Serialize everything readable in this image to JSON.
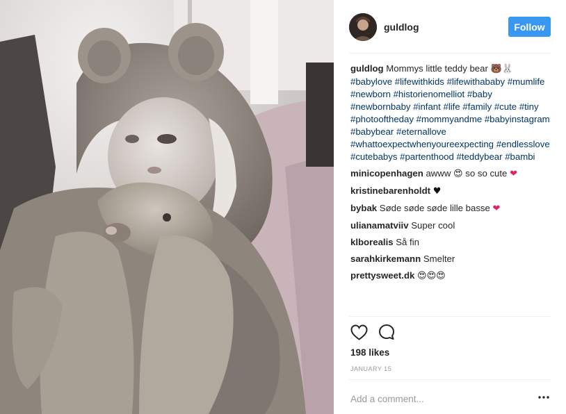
{
  "post": {
    "username": "guldlog",
    "follow_label": "Follow",
    "caption_text": "Mommys little teddy bear",
    "caption_emojis": "🐻🐰",
    "hashtags": [
      "#babylove",
      "#lifewithkids",
      "#lifewithababy",
      "#mumlife",
      "#newborn",
      "#historienomelliot",
      "#baby",
      "#newbornbaby",
      "#infant",
      "#life",
      "#family",
      "#cute",
      "#tiny",
      "#photooftheday",
      "#mommyandme",
      "#babyinstagram",
      "#babybear",
      "#eternallove",
      "#whattoexpectwhenyoureexpecting",
      "#endlesslove",
      "#cutebabys",
      "#partenthood",
      "#teddybear",
      "#bambi"
    ],
    "comments": [
      {
        "user": "minicopenhagen",
        "text": "awww",
        "emoji": "😍",
        "text2": "so so cute",
        "emoji2": "❤"
      },
      {
        "user": "kristinebarenholdt",
        "text": "",
        "emoji": "♥",
        "text2": "",
        "emoji2": ""
      },
      {
        "user": "bybak",
        "text": "Søde søde søde lille basse",
        "emoji": "❤",
        "text2": "",
        "emoji2": ""
      },
      {
        "user": "ulianamatviiv",
        "text": "Super cool",
        "emoji": "",
        "text2": "",
        "emoji2": ""
      },
      {
        "user": "klborealis",
        "text": "Så fin",
        "emoji": "",
        "text2": "",
        "emoji2": ""
      },
      {
        "user": "sarahkirkemann",
        "text": "Smelter",
        "emoji": "",
        "text2": "",
        "emoji2": ""
      },
      {
        "user": "prettysweet.dk",
        "text": "",
        "emoji": "😍😍😍",
        "text2": "",
        "emoji2": ""
      }
    ],
    "likes": "198 likes",
    "date": "JANUARY 15",
    "comment_placeholder": "Add a comment...",
    "more_icon": "⋯"
  },
  "icons": {
    "heart": "heart-outline-icon",
    "comment": "speech-bubble-icon",
    "more": "ellipsis-icon"
  },
  "colors": {
    "follow_bg": "#3897f0",
    "hashtag": "#003569",
    "muted": "#999999",
    "divider": "#efefef"
  }
}
